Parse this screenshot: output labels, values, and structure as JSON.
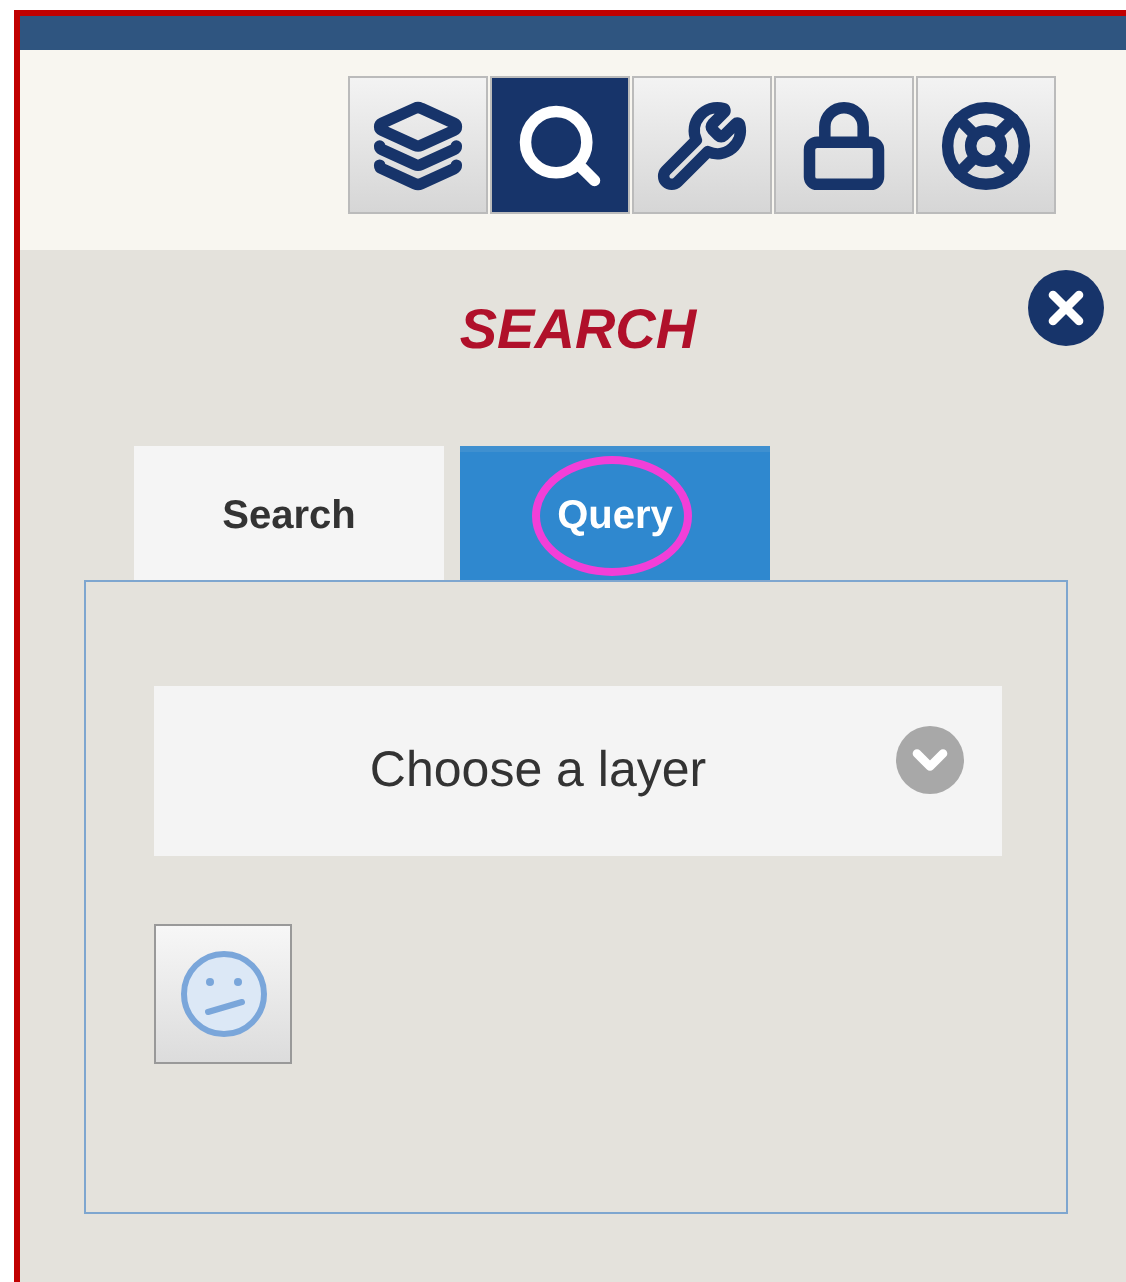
{
  "toolbar": [
    {
      "kind": "layers",
      "selected": false
    },
    {
      "kind": "search",
      "selected": true
    },
    {
      "kind": "tools",
      "selected": false
    },
    {
      "kind": "lock",
      "selected": false
    },
    {
      "kind": "help",
      "selected": false
    }
  ],
  "panel": {
    "title": "SEARCH",
    "tabs": [
      {
        "label": "Search",
        "selected": false,
        "circled": false
      },
      {
        "label": "Query",
        "selected": true,
        "circled": true
      }
    ],
    "layer_select": {
      "placeholder": "Choose a layer"
    }
  }
}
